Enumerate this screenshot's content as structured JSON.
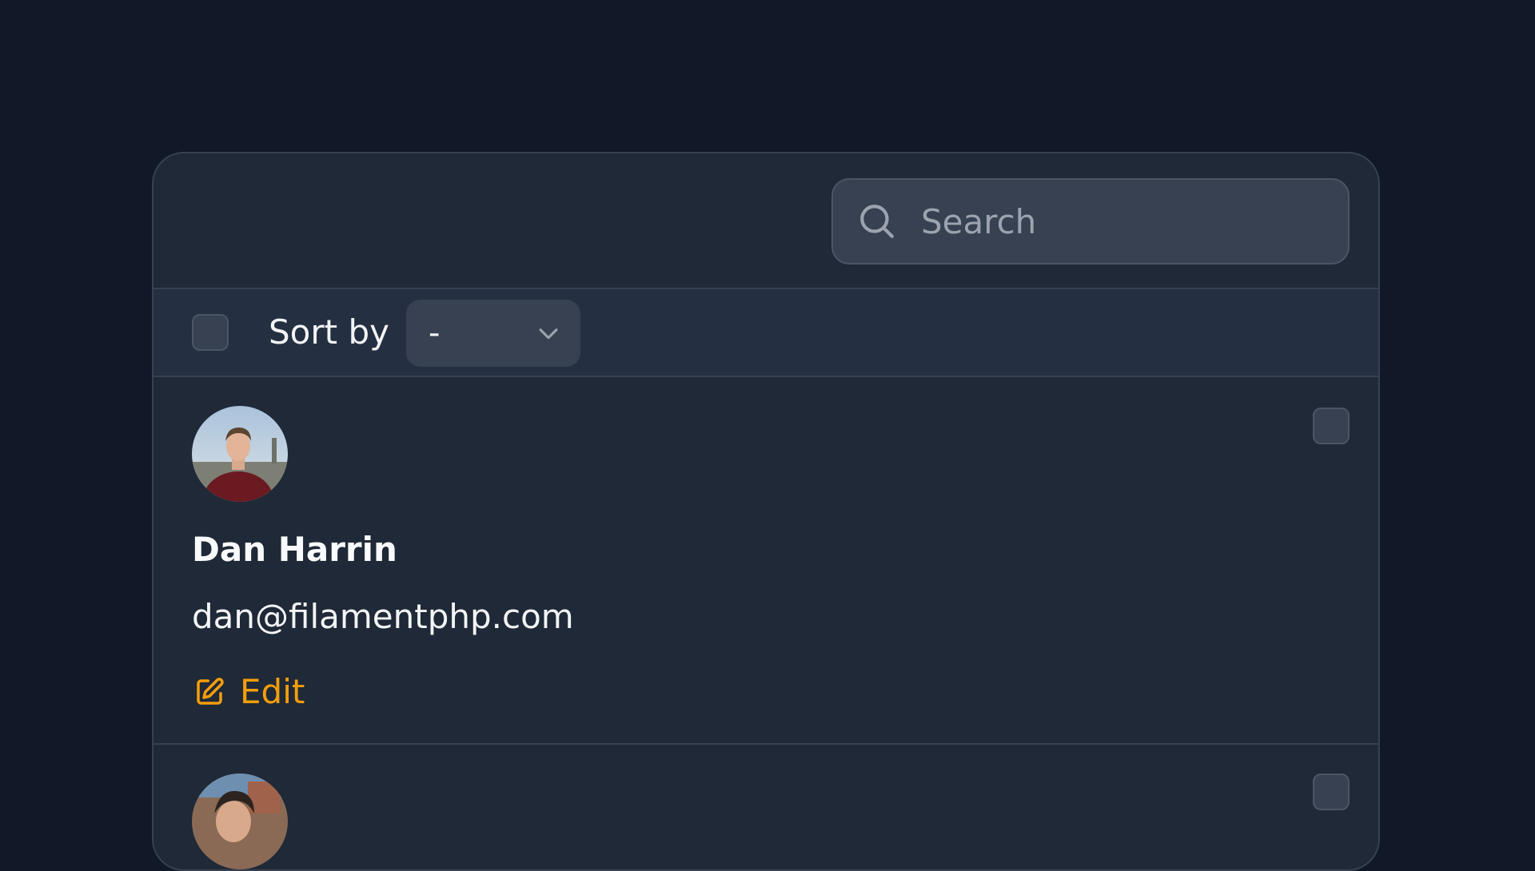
{
  "search": {
    "placeholder": "Search"
  },
  "toolbar": {
    "sort_label": "Sort by",
    "sort_selected": "-"
  },
  "records": [
    {
      "name": "Dan Harrin",
      "email": "dan@filamentphp.com",
      "edit_label": "Edit"
    }
  ],
  "colors": {
    "background": "#111827",
    "card": "#1f2937",
    "accent": "#f59e0b"
  }
}
